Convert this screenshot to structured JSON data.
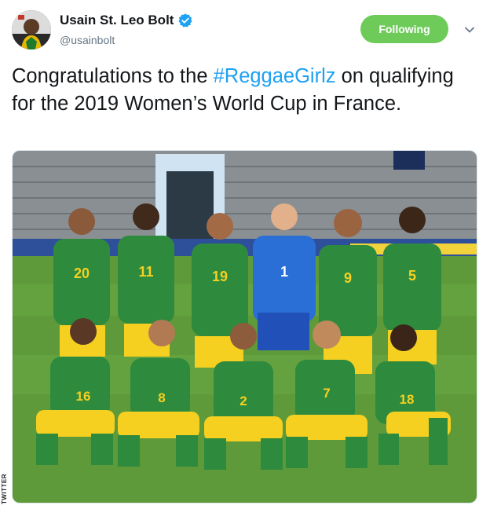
{
  "author": {
    "display_name": "Usain St. Leo Bolt",
    "handle": "@usainbolt",
    "verified_icon": "verified-badge-icon"
  },
  "follow_button": {
    "label": "Following"
  },
  "menu": {
    "icon": "chevron-down-icon"
  },
  "tweet": {
    "text_before": "Congratulations to the ",
    "hashtag": "#ReggaeGirlz",
    "text_after": " on qualifying for the 2019 Women’s World Cup in France."
  },
  "photo": {
    "jersey_numbers_back_row": [
      "20",
      "11",
      "19",
      "1",
      "9",
      "5"
    ],
    "jersey_numbers_front_row": [
      "16",
      "8",
      "2",
      "7",
      "18"
    ]
  },
  "watermark": {
    "label": "TWITTER"
  },
  "colors": {
    "follow_green": "#6ecb5a",
    "hashtag_blue": "#1da1f2",
    "kit_green": "#2e8b3d",
    "kit_yellow": "#f5d020",
    "keeper_blue": "#2a6fd6"
  }
}
